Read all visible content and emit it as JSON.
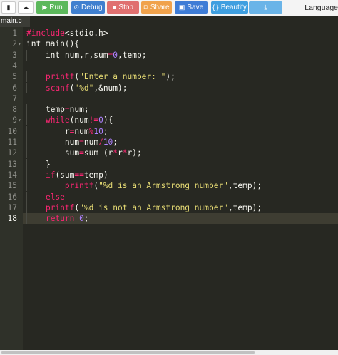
{
  "toolbar": {
    "file_icon": "file-icon",
    "upload_icon": "upload-icon",
    "run_label": "Run",
    "debug_label": "Debug",
    "stop_label": "Stop",
    "share_label": "Share",
    "save_label": "Save",
    "beautify_label": "Beautify",
    "download_icon": "download-icon",
    "language_label": "Language",
    "colors": {
      "run": "#5cb85c",
      "debug": "#3f7fcf",
      "stop": "#e07070",
      "share": "#f0a24c",
      "save": "#3e7cd6",
      "beautify": "#3f9fe0",
      "download": "#6ab4e8"
    }
  },
  "tab": {
    "filename": "main.c"
  },
  "editor": {
    "theme": "monokai",
    "active_line": 18,
    "line_numbers": [
      "1",
      "2",
      "3",
      "4",
      "5",
      "6",
      "7",
      "8",
      "9",
      "10",
      "11",
      "12",
      "13",
      "14",
      "15",
      "16",
      "17",
      "18"
    ],
    "fold_markers": {
      "2": "▾",
      "9": "▾"
    },
    "lines": [
      [
        [
          "pre",
          "#include"
        ],
        [
          "id",
          "<stdio.h>"
        ]
      ],
      [
        [
          "id",
          "int main(){"
        ]
      ],
      [
        [
          "id",
          "    int num,r,sum"
        ],
        [
          "op",
          "="
        ],
        [
          "num",
          "0"
        ],
        [
          "id",
          ",temp;"
        ]
      ],
      [],
      [
        [
          "id",
          "    "
        ],
        [
          "fn",
          "printf"
        ],
        [
          "id",
          "("
        ],
        [
          "str",
          "\"Enter a number: \""
        ],
        [
          "id",
          ");"
        ]
      ],
      [
        [
          "id",
          "    "
        ],
        [
          "fn",
          "scanf"
        ],
        [
          "id",
          "("
        ],
        [
          "str",
          "\"%d\""
        ],
        [
          "id",
          ",&num);"
        ]
      ],
      [],
      [
        [
          "id",
          "    temp"
        ],
        [
          "op",
          "="
        ],
        [
          "id",
          "num;"
        ]
      ],
      [
        [
          "id",
          "    "
        ],
        [
          "kw",
          "while"
        ],
        [
          "id",
          "(num"
        ],
        [
          "op",
          "!="
        ],
        [
          "num",
          "0"
        ],
        [
          "id",
          "){"
        ]
      ],
      [
        [
          "id",
          "        r"
        ],
        [
          "op",
          "="
        ],
        [
          "id",
          "num"
        ],
        [
          "op",
          "%"
        ],
        [
          "num",
          "10"
        ],
        [
          "id",
          ";"
        ]
      ],
      [
        [
          "id",
          "        num"
        ],
        [
          "op",
          "="
        ],
        [
          "id",
          "num"
        ],
        [
          "op",
          "/"
        ],
        [
          "num",
          "10"
        ],
        [
          "id",
          ";"
        ]
      ],
      [
        [
          "id",
          "        sum"
        ],
        [
          "op",
          "="
        ],
        [
          "id",
          "sum"
        ],
        [
          "op",
          "+"
        ],
        [
          "id",
          "(r"
        ],
        [
          "op",
          "*"
        ],
        [
          "id",
          "r"
        ],
        [
          "op",
          "*"
        ],
        [
          "id",
          "r);"
        ]
      ],
      [
        [
          "id",
          "    }"
        ]
      ],
      [
        [
          "id",
          "    "
        ],
        [
          "kw",
          "if"
        ],
        [
          "id",
          "(sum"
        ],
        [
          "op",
          "=="
        ],
        [
          "id",
          "temp)"
        ]
      ],
      [
        [
          "id",
          "        "
        ],
        [
          "fn",
          "printf"
        ],
        [
          "id",
          "("
        ],
        [
          "str",
          "\"%d is an Armstrong number\""
        ],
        [
          "id",
          ",temp);"
        ]
      ],
      [
        [
          "id",
          "    "
        ],
        [
          "kw",
          "else"
        ]
      ],
      [
        [
          "id",
          "    "
        ],
        [
          "fn",
          "printf"
        ],
        [
          "id",
          "("
        ],
        [
          "str",
          "\"%d is not an Armstrong number\""
        ],
        [
          "id",
          ",temp);"
        ]
      ],
      [
        [
          "id",
          "    "
        ],
        [
          "kw",
          "return"
        ],
        [
          "id",
          " "
        ],
        [
          "num",
          "0"
        ],
        [
          "id",
          ";"
        ]
      ]
    ]
  }
}
